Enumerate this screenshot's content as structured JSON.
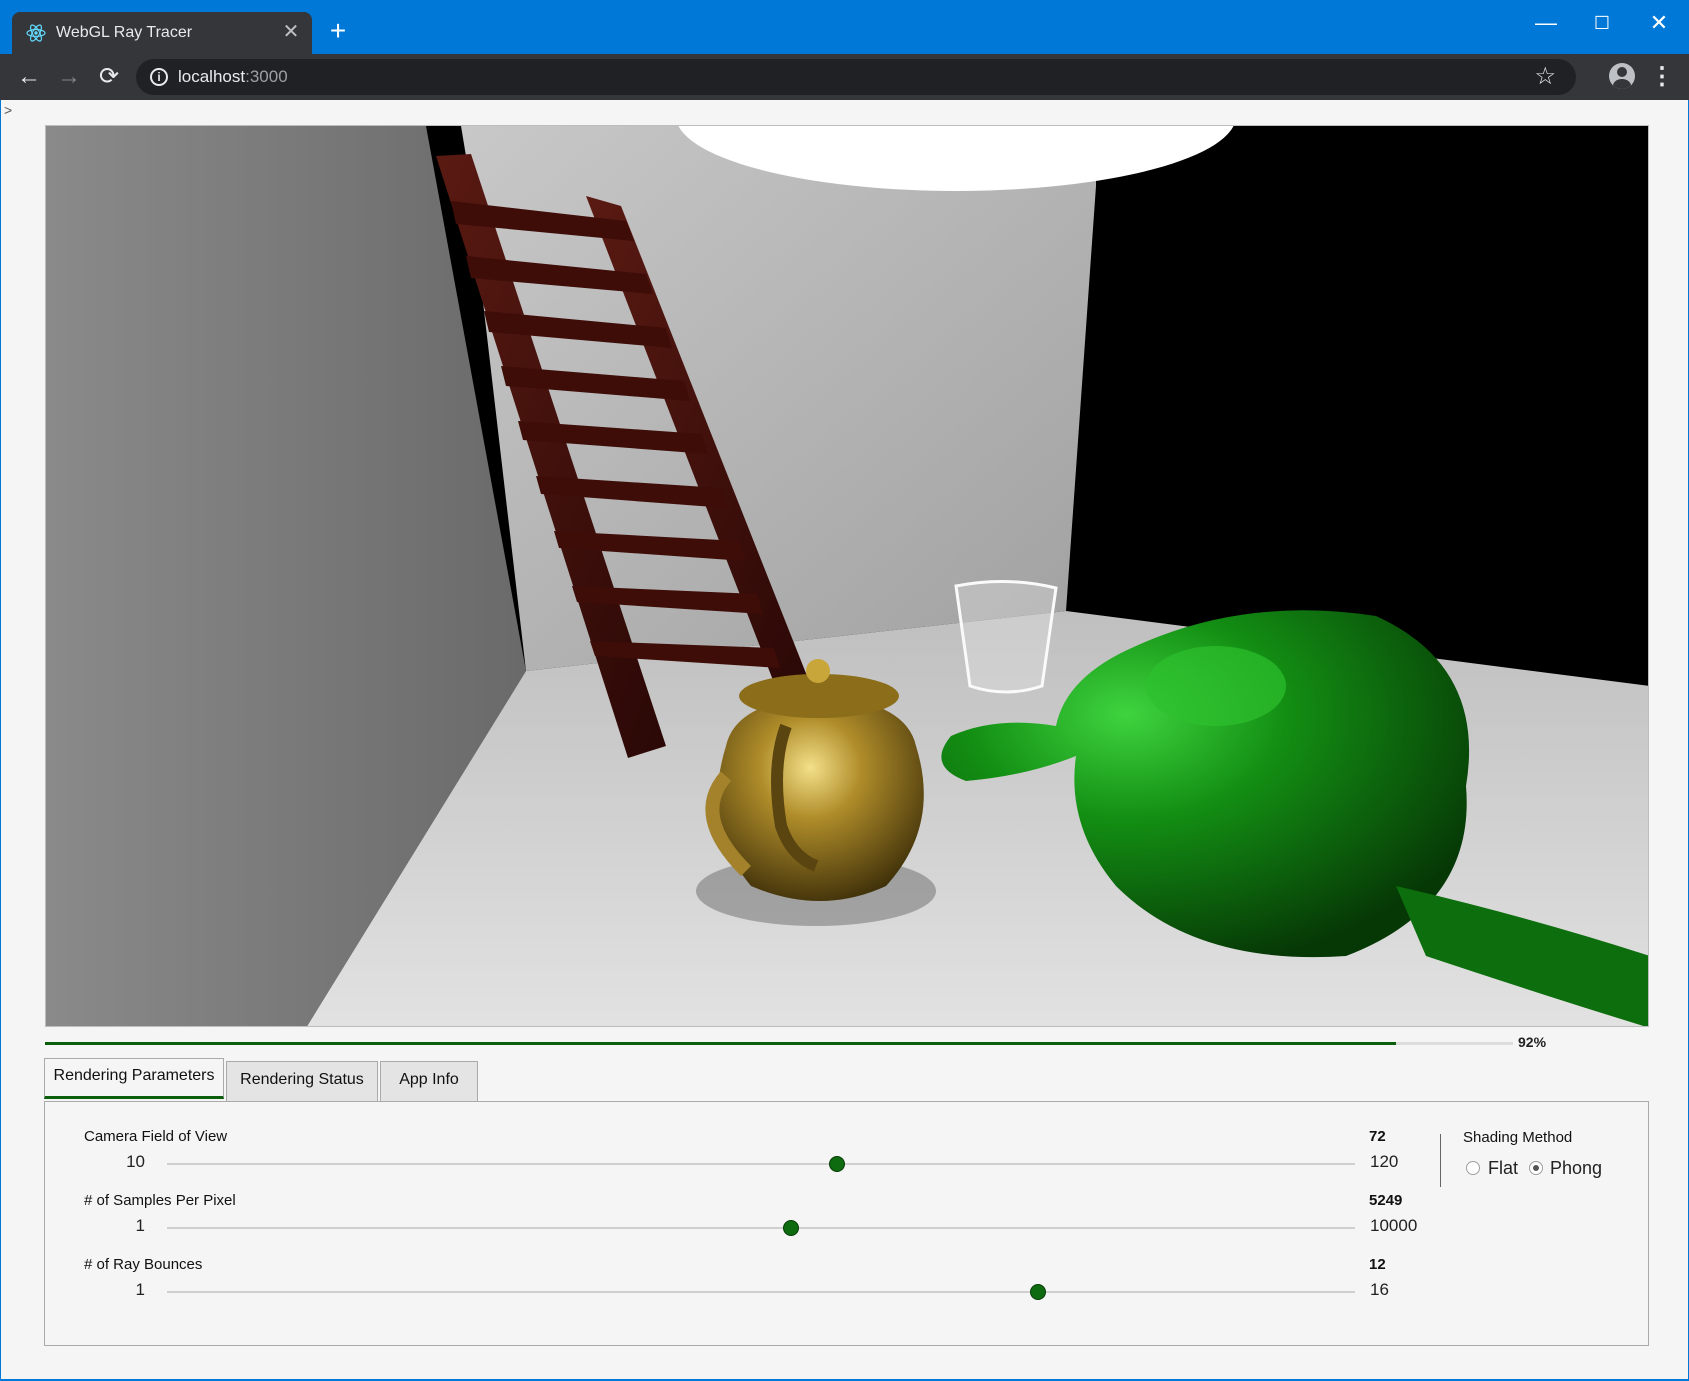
{
  "browser": {
    "tab_title": "WebGL Ray Tracer",
    "tab_close": "✕",
    "new_tab": "+",
    "url_host": "localhost",
    "url_port": ":3000",
    "window_controls": {
      "minimize": "—",
      "maximize": "☐",
      "close": "✕"
    },
    "nav": {
      "back": "←",
      "forward": "→",
      "reload": "⟳"
    }
  },
  "page": {
    "caret": ">",
    "progress": {
      "percent": 92,
      "label": "92%"
    },
    "tabs": [
      {
        "label": "Rendering Parameters",
        "active": true
      },
      {
        "label": "Rendering Status",
        "active": false
      },
      {
        "label": "App Info",
        "active": false
      }
    ],
    "sliders": [
      {
        "label": "Camera Field of View",
        "min": 10,
        "max": 120,
        "value": 72,
        "min_label": "10",
        "max_label": "120",
        "value_label": "72"
      },
      {
        "label": "# of Samples Per Pixel",
        "min": 1,
        "max": 10000,
        "value": 5249,
        "min_label": "1",
        "max_label": "10000",
        "value_label": "5249"
      },
      {
        "label": "# of Ray Bounces",
        "min": 1,
        "max": 16,
        "value": 12,
        "min_label": "1",
        "max_label": "16",
        "value_label": "12"
      }
    ],
    "shading": {
      "title": "Shading Method",
      "options": [
        {
          "label": "Flat",
          "checked": false
        },
        {
          "label": "Phong",
          "checked": true
        }
      ]
    }
  },
  "colors": {
    "accent": "#0b5e0b",
    "chrome_blue": "#0078d7",
    "toolbar": "#35363a"
  }
}
